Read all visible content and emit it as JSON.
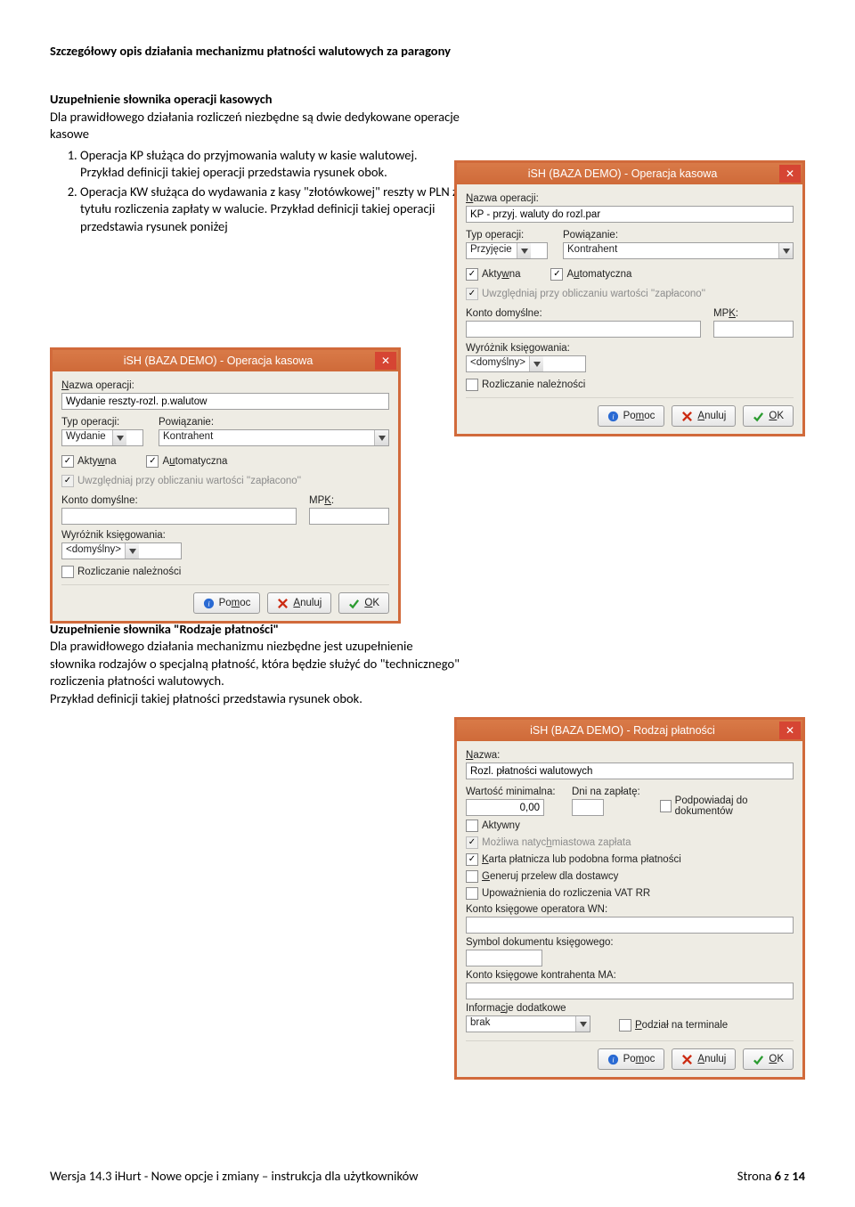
{
  "page": {
    "title": "Szczegółowy opis działania mechanizmu płatności walutowych za paragony"
  },
  "sectionA": {
    "heading": "Uzupełnienie słownika operacji kasowych",
    "intro": "Dla prawidłowego działania rozliczeń niezbędne są dwie dedykowane operacje kasowe",
    "item1": "Operacja KP służąca do przyjmowania waluty w kasie walutowej.",
    "item1b": "Przykład definicji takiej operacji przedstawia rysunek obok.",
    "item2": "Operacja KW służąca do wydawania z kasy \"złotówkowej\"  reszty w PLN z tytułu rozliczenia zapłaty w walucie.  Przykład definicji takiej operacji przedstawia rysunek poniżej"
  },
  "sectionB": {
    "heading": "Uzupełnienie słownika \"Rodzaje płatności\"",
    "text1": "Dla prawidłowego działania mechanizmu niezbędne jest uzupełnienie słownika rodzajów o specjalną płatność, która będzie służyć do \"technicznego\" rozliczenia płatności walutowych.",
    "text2": "Przykład definicji takiej płatności przedstawia rysunek obok."
  },
  "dialogRight": {
    "title": "iSH (BAZA DEMO) - Operacja kasowa",
    "lbl_name": "Nazwa operacji:",
    "name_value": "KP - przyj. waluty do rozl.par",
    "lbl_type": "Typ operacji:",
    "type_value": "Przyjęcie",
    "lbl_link": "Powiązanie:",
    "link_value": "Kontrahent",
    "chk_aktywna": "Aktywna",
    "chk_auto": "Automatyczna",
    "chk_uw": "Uwzględniaj przy obliczaniu wartości ''zapłacono''",
    "lbl_konto": "Konto domyślne:",
    "lbl_mpk": "MPK:",
    "lbl_wyr": "Wyróżnik księgowania:",
    "wyr_value": "<domyślny>",
    "chk_rozl": "Rozliczanie należności",
    "btn_help": "Pomoc",
    "btn_cancel": "Anuluj",
    "btn_ok": "OK"
  },
  "dialogLeft": {
    "title": "iSH (BAZA DEMO) - Operacja kasowa",
    "lbl_name": "Nazwa operacji:",
    "name_value": "Wydanie reszty-rozl. p.walutow",
    "lbl_type": "Typ operacji:",
    "type_value": "Wydanie",
    "lbl_link": "Powiązanie:",
    "link_value": "Kontrahent",
    "chk_aktywna": "Aktywna",
    "chk_auto": "Automatyczna",
    "chk_uw": "Uwzględniaj przy obliczaniu wartości ''zapłacono''",
    "lbl_konto": "Konto domyślne:",
    "lbl_mpk": "MPK:",
    "lbl_wyr": "Wyróżnik księgowania:",
    "wyr_value": "<domyślny>",
    "chk_rozl": "Rozliczanie należności",
    "btn_help": "Pomoc",
    "btn_cancel": "Anuluj",
    "btn_ok": "OK"
  },
  "dialogBottom": {
    "title": "iSH (BAZA DEMO) - Rodzaj płatności",
    "lbl_name": "Nazwa:",
    "name_value": "Rozl. płatności walutowych",
    "lbl_wmin": "Wartość minimalna:",
    "wmin_value": "0,00",
    "lbl_dni": "Dni na zapłatę:",
    "dni_value": "",
    "chk_podpow": "Podpowiadaj do dokumentów",
    "chk_aktywny": "Aktywny",
    "chk_natych": "Możliwa natychmiastowa zapłata",
    "chk_karta": "Karta płatnicza lub podobna forma płatności",
    "chk_przelew": "Generuj przelew dla dostawcy",
    "chk_rr": "Upoważnienia do rozliczenia VAT RR",
    "lbl_konto_wn": "Konto księgowe operatora WN:",
    "lbl_symbol": "Symbol dokumentu księgowego:",
    "lbl_konto_ma": "Konto księgowe kontrahenta MA:",
    "lbl_info": "Informacje dodatkowe",
    "info_value": "brak",
    "chk_podzial": "Podział na terminale",
    "btn_help": "Pomoc",
    "btn_cancel": "Anuluj",
    "btn_ok": "OK"
  },
  "footer": {
    "left": "Wersja 14.3 iHurt - Nowe opcje i zmiany – instrukcja dla użytkowników",
    "right_a": "Strona ",
    "right_b": "6",
    "right_c": " z ",
    "right_d": "14"
  }
}
